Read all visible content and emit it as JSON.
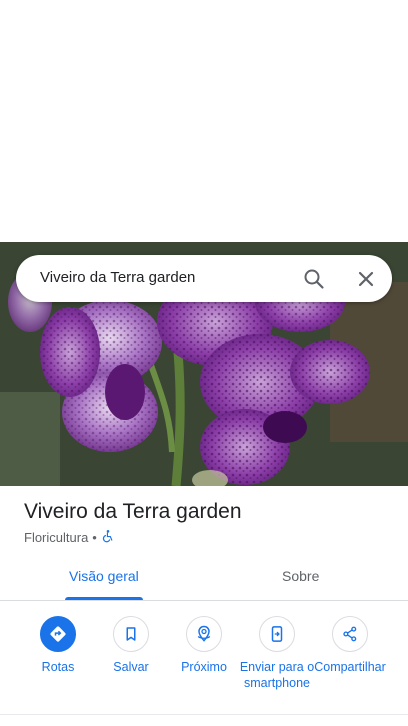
{
  "search": {
    "query": "Viveiro da Terra garden"
  },
  "place": {
    "title": "Viveiro da Terra garden",
    "category": "Floricultura",
    "separator": "•"
  },
  "tabs": [
    {
      "label": "Visão geral",
      "selected": true
    },
    {
      "label": "Sobre",
      "selected": false
    }
  ],
  "actions": [
    {
      "label": "Rotas",
      "icon": "directions-icon"
    },
    {
      "label": "Salvar",
      "icon": "bookmark-icon"
    },
    {
      "label": "Próximo",
      "icon": "nearby-icon"
    },
    {
      "label": "Enviar para o smartphone",
      "icon": "send-to-phone-icon"
    },
    {
      "label": "Compartilhar",
      "icon": "share-icon"
    }
  ],
  "colors": {
    "accent": "#1a73e8",
    "text": "#202124",
    "secondary": "#5f6368"
  }
}
